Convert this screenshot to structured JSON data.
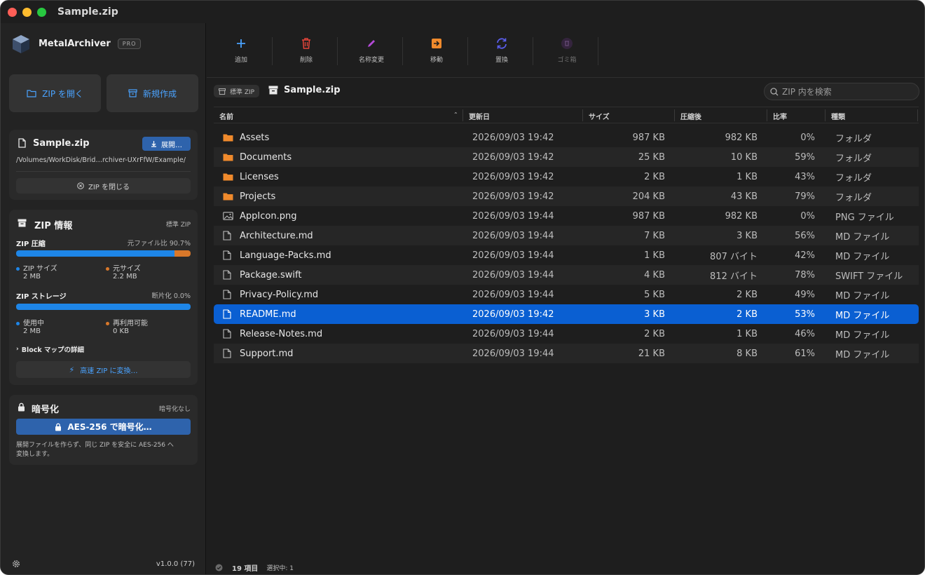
{
  "window": {
    "title": "Sample.zip"
  },
  "sidebar": {
    "app_name": "MetalArchiver",
    "badge": "PRO",
    "open_zip_label": "ZIP を開く",
    "new_label": "新規作成",
    "file_card": {
      "name": "Sample.zip",
      "extract_label": "展開…",
      "path": "/Volumes/WorkDisk/Brid…rchiver-UXrFfW/Example/",
      "close_label": "ZIP を閉じる"
    },
    "zip_info": {
      "title": "ZIP 情報",
      "kind": "標準 ZIP",
      "compression_label": "ZIP 圧縮",
      "compression_ratio_text": "元ファイル比 90.7%",
      "compression_fraction": 0.907,
      "zip_size_label": "ZIP サイズ",
      "zip_size_value": "2 MB",
      "orig_size_label": "元サイズ",
      "orig_size_value": "2.2 MB",
      "storage_label": "ZIP ストレージ",
      "fragmentation_text": "断片化 0.0%",
      "storage_fraction": 1.0,
      "used_label": "使用中",
      "used_value": "2 MB",
      "reusable_label": "再利用可能",
      "reusable_value": "0 KB",
      "blockmap_label": "Block マップの詳細",
      "convert_label": "高速 ZIP に変換…"
    },
    "encryption": {
      "title": "暗号化",
      "status": "暗号化なし",
      "button_label": "AES-256 で暗号化…",
      "description_line1": "展開ファイルを作らず、同じ ZIP を安全に AES-256 へ",
      "description_line2": "変換します。"
    },
    "version": "v1.0.0 (77)"
  },
  "toolbar": {
    "add": "追加",
    "delete": "削除",
    "rename": "名称変更",
    "move": "移動",
    "replace": "置換",
    "trash": "ゴミ箱"
  },
  "pathbar": {
    "tag": "標準 ZIP",
    "title": "Sample.zip",
    "search_placeholder": "ZIP 内を検索"
  },
  "table": {
    "columns": [
      "名前",
      "更新日",
      "サイズ",
      "圧縮後",
      "比率",
      "種類"
    ],
    "rows": [
      {
        "name": "Assets",
        "date": "2026/09/03 19:42",
        "size": "987 KB",
        "compressed": "982 KB",
        "ratio": "0%",
        "kind": "フォルダ",
        "icon": "folder-icon"
      },
      {
        "name": "Documents",
        "date": "2026/09/03 19:42",
        "size": "25 KB",
        "compressed": "10 KB",
        "ratio": "59%",
        "kind": "フォルダ",
        "icon": "folder-icon"
      },
      {
        "name": "Licenses",
        "date": "2026/09/03 19:42",
        "size": "2 KB",
        "compressed": "1 KB",
        "ratio": "43%",
        "kind": "フォルダ",
        "icon": "folder-icon"
      },
      {
        "name": "Projects",
        "date": "2026/09/03 19:42",
        "size": "204 KB",
        "compressed": "43 KB",
        "ratio": "79%",
        "kind": "フォルダ",
        "icon": "folder-icon"
      },
      {
        "name": "AppIcon.png",
        "date": "2026/09/03 19:44",
        "size": "987 KB",
        "compressed": "982 KB",
        "ratio": "0%",
        "kind": "PNG ファイル",
        "icon": "image-icon"
      },
      {
        "name": "Architecture.md",
        "date": "2026/09/03 19:44",
        "size": "7 KB",
        "compressed": "3 KB",
        "ratio": "56%",
        "kind": "MD ファイル",
        "icon": "document-icon"
      },
      {
        "name": "Language-Packs.md",
        "date": "2026/09/03 19:44",
        "size": "1 KB",
        "compressed": "807 バイト",
        "ratio": "42%",
        "kind": "MD ファイル",
        "icon": "document-icon"
      },
      {
        "name": "Package.swift",
        "date": "2026/09/03 19:44",
        "size": "4 KB",
        "compressed": "812 バイト",
        "ratio": "78%",
        "kind": "SWIFT ファイル",
        "icon": "document-icon"
      },
      {
        "name": "Privacy-Policy.md",
        "date": "2026/09/03 19:44",
        "size": "5 KB",
        "compressed": "2 KB",
        "ratio": "49%",
        "kind": "MD ファイル",
        "icon": "document-icon"
      },
      {
        "name": "README.md",
        "date": "2026/09/03 19:42",
        "size": "3 KB",
        "compressed": "2 KB",
        "ratio": "53%",
        "kind": "MD ファイル",
        "icon": "document-icon",
        "selected": true
      },
      {
        "name": "Release-Notes.md",
        "date": "2026/09/03 19:44",
        "size": "2 KB",
        "compressed": "1 KB",
        "ratio": "46%",
        "kind": "MD ファイル",
        "icon": "document-icon"
      },
      {
        "name": "Support.md",
        "date": "2026/09/03 19:44",
        "size": "21 KB",
        "compressed": "8 KB",
        "ratio": "61%",
        "kind": "MD ファイル",
        "icon": "document-icon"
      }
    ]
  },
  "status": {
    "count": "19 項目",
    "selected": "選択中: 1"
  },
  "colors": {
    "accent": "#1e86e8",
    "selection": "#0a5fd2",
    "folder": "#f08a2c",
    "delete": "#e5453a",
    "rename": "#b44ad8",
    "move": "#f08a2c",
    "replace": "#5b5ff0"
  }
}
